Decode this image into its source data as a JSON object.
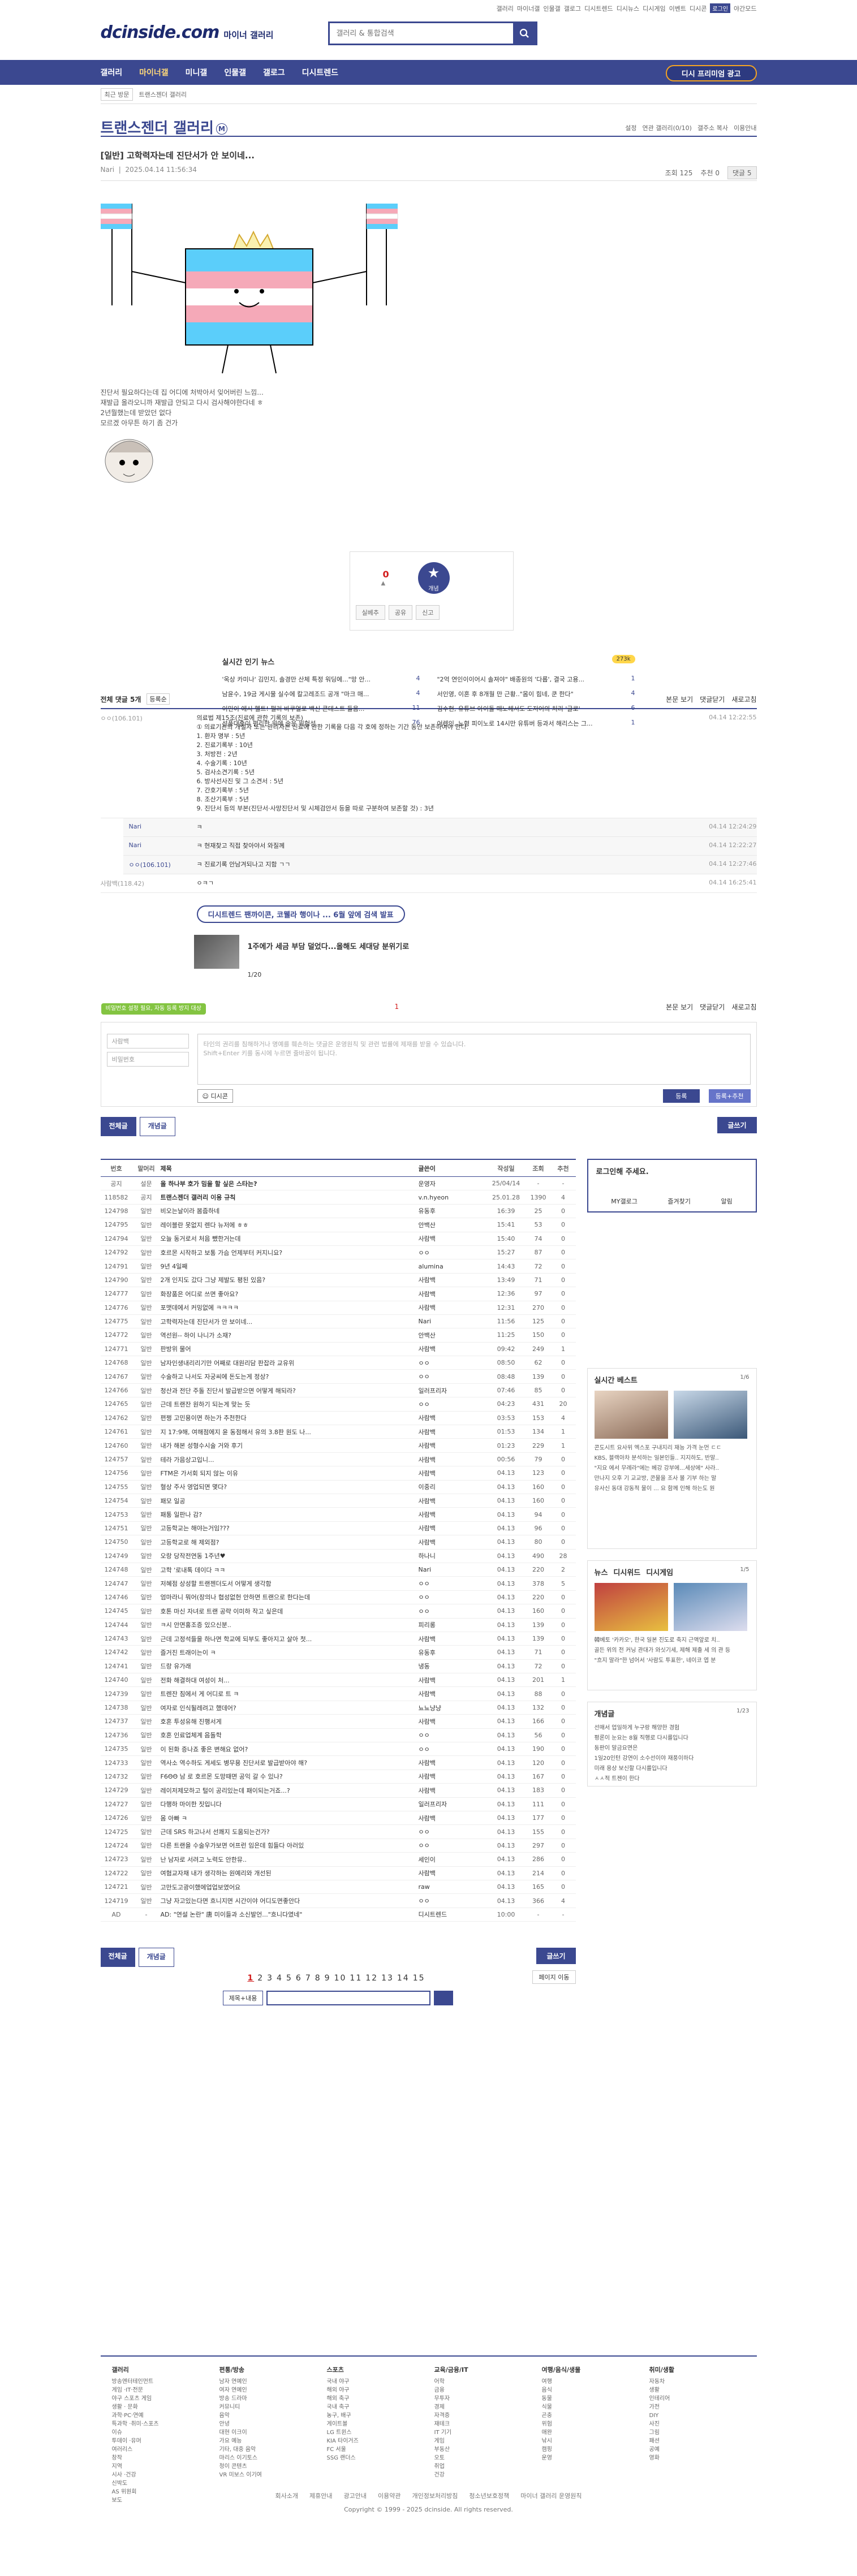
{
  "util": {
    "links": [
      "갤러리",
      "마이너갤",
      "인물갤",
      "갤로그",
      "디시트렌드",
      "디시뉴스",
      "디시게임",
      "이벤트",
      "디시콘",
      "로그인",
      "야간모드"
    ]
  },
  "header": {
    "logo": "dcinside.com",
    "logo_sub": "마이너 갤러리",
    "search_placeholder": "갤러리 & 통합검색"
  },
  "gnb": {
    "items": [
      "갤러리",
      "마이너갤",
      "미니갤",
      "인물갤",
      "갤로그",
      "디시트렌드"
    ],
    "cta": "디시 프리미엄 광고"
  },
  "crumb": {
    "recent": "최근 방문",
    "path": "트랜스젠더 갤러리",
    "close": "전체"
  },
  "gallery": {
    "title": "트랜스젠더 갤러리",
    "badge": "M",
    "opts": [
      "설정",
      "연관 갤러리(0/10)",
      "갤주소 복사",
      "이용안내"
    ]
  },
  "post": {
    "title": "[일반] 고학력자는데 진단서가 안 보이네...",
    "author": "Nari",
    "date": "2025.04.14 11:56:34",
    "views": "조회 125",
    "recommend": "추천 0",
    "comments": "댓글 5",
    "lines": [
      "진단서 필요하다는데 집 어디에 처박아서 잊어버린 느낌...",
      "재발급 올라오니까 재발급 안되고 다시 검사해야한다네 ㅎ",
      "2년뭘했는데 받았던 없다",
      "모르겠 아무튼 하기 좀 건가"
    ],
    "vote_count": "0",
    "vote_label": "개념",
    "vote_btns": [
      "실베추",
      "공유",
      "신고"
    ]
  },
  "news": {
    "title": "실시간 인기 뉴스",
    "badge": "273k",
    "items": [
      {
        "t": "'옥상 카미나' 김민지, 솔경만 산체 특정 워딩에...\"망 안...",
        "c": "4"
      },
      {
        "t": "\"2억 연인이이어시 솔져야\" 배종원의 '다롭', 결국 고용...",
        "c": "1"
      },
      {
        "t": "남윤수, 19금 게시물 실수에 칼고레조드 공개 \"마크 매...",
        "c": "4"
      },
      {
        "t": "서인영, 이혼 후 8개월 만 근황..\"몸이 힘네, 쿤 한다\"",
        "c": "4"
      },
      {
        "t": "이민이 에시 헬트! 펄러 바쿠얼로 백신 콘테스트 들음...",
        "c": "11"
      },
      {
        "t": "김수현, 유튜브 아이돌 매노헤서도 도저어의 처리 '글로'",
        "c": "6"
      },
      {
        "t": "선풍대출이 편리한 위에 술은 위험성",
        "c": "76"
      },
      {
        "t": "어렌인, 노형 피이노로 14시만 유튜버 등과서 해리스는 그...",
        "c": "1"
      }
    ]
  },
  "comments": {
    "header": "전체 댓글 5개",
    "sort": "등록순",
    "right": [
      "본문 보기",
      "댓글닫기",
      "새로고침"
    ],
    "list": [
      {
        "who": "ㅇㅇ(106.101)",
        "txt": [
          "의료법 제15조(진료에 관한 기록의 보존)",
          "① 의료기관의 개설자 또는 관리자는 진료에 관한 기록을 다음 각 호에 정하는 기간 동안 보존하여야 한다.",
          "1. 환자 명부 : 5년",
          "2. 진료기록부 : 10년",
          "3. 처방전 : 2년",
          "4. 수술기록 : 10년",
          "5. 검사소견기록 : 5년",
          "6. 방사선사진 및 그 소견서 : 5년",
          "7. 간호기록부 : 5년",
          "8. 조산기록부 : 5년",
          "9. 진단서 등의 부본(진단서·사망진단서 및 시체검안서 등을 따로 구분하여 보존할 것) : 3년"
        ],
        "dt": "04.14 12:22:55",
        "reply": false
      },
      {
        "who": "Nari",
        "txt": [
          "ㅋ"
        ],
        "dt": "04.14 12:24:29",
        "reply": true
      },
      {
        "who": "Nari",
        "txt": [
          "ㅋ 현재찾고 직접 찾아야서 와질께"
        ],
        "dt": "04.14 12:22:27",
        "reply": true
      },
      {
        "who": "ㅇㅇ(106.101)",
        "txt": [
          "ㅋ 진료기록 안남겨되나고 지함 ㄱㄱ"
        ],
        "dt": "04.14 12:27:46",
        "reply": true
      },
      {
        "who": "사람백(118.42)",
        "txt": [
          "ㅇㅋㄱ"
        ],
        "dt": "04.14 16:25:41",
        "reply": false
      }
    ],
    "write_hint": "타인의 권리를 침해하거나 명예를 훼손하는 댓글은 운영원칙 및 관련 법률에 제재를 받을 수 있습니다.",
    "write_hint2": "Shift+Enter 키를 동시에 누르면 줄바꿈이 됩니다.",
    "name_ph": "사람백",
    "pw_ph": "비밀번호",
    "dccon": "디시콘",
    "submit": "등록",
    "submit2": "등록+추천",
    "bubble": "비밀번호 설정 필요, 자동 등록 방지 대상"
  },
  "ad": {
    "pill": "디시트렌드 팬까이콘, 코웰라 행이나 ... 6월 앞에 검색 발표",
    "title": "1주에가 세금 부담 덜었다...올해도 세대당 분위기로",
    "page": "1/20"
  },
  "tabs": {
    "all": "전체글",
    "best": "개념글",
    "write": "글쓰기"
  },
  "list": {
    "headers": [
      "번호",
      "말머리",
      "제목",
      "글쓴이",
      "작성일",
      "조회",
      "추천"
    ],
    "rows": [
      [
        "공지",
        "설문",
        "올 하나부 호가 밈을 할 싶은 스타는?",
        "운영자",
        "25/04/14",
        "-",
        "-"
      ],
      [
        "118582",
        "공지",
        "트랜스젠더 갤러리 이용 규칙",
        "v.n.hyeon",
        "25.01.28",
        "1390",
        "4"
      ],
      [
        "124798",
        "일반",
        "비오는날이라 봄줍하네",
        "유동후",
        "16:39",
        "25",
        "0"
      ],
      [
        "124795",
        "일반",
        "레이블란 못없지 렌다 뉴저에 ㅎㅎ",
        "안백산",
        "15:41",
        "53",
        "0"
      ],
      [
        "124794",
        "일반",
        "오늘 동거로서 처음 뺐한거는데",
        "사람백",
        "15:40",
        "74",
        "0"
      ],
      [
        "124792",
        "일반",
        "호르몬 시작하고 보통 가슴 언제부터 커지니요?",
        "ㅇㅇ",
        "15:27",
        "87",
        "0"
      ],
      [
        "124791",
        "일반",
        "9년 4일째",
        "alumina",
        "14:43",
        "72",
        "0"
      ],
      [
        "124790",
        "일반",
        "2개 인지도 갔다 그냥 제발도 평된 있음?",
        "사람백",
        "13:49",
        "71",
        "0"
      ],
      [
        "124777",
        "일반",
        "화장품은 어디로 쓰면 좋아요?",
        "사람백",
        "12:36",
        "97",
        "0"
      ],
      [
        "124776",
        "일반",
        "포맷데에서 커밍없에 ㅋㅋㅋㅋ",
        "사람백",
        "12:31",
        "270",
        "0"
      ],
      [
        "124775",
        "일반",
        "고학력자는데 진단서가 안 보이네...",
        "Nari",
        "11:56",
        "125",
        "0"
      ],
      [
        "124772",
        "일반",
        "역선원-- 하이 나니가 소재?",
        "안백산",
        "11:25",
        "150",
        "0"
      ],
      [
        "124771",
        "일반",
        "판방위 물어",
        "사람백",
        "09:42",
        "249",
        "1"
      ],
      [
        "124768",
        "일반",
        "남자인생내리리기만 어째로 대원리담 판잡라 교유위",
        "ㅇㅇ",
        "08:50",
        "62",
        "0"
      ],
      [
        "124767",
        "일반",
        "수술하고 나서도 자궁씨에 돈도는게 정상?",
        "ㅇㅇ",
        "08:48",
        "139",
        "0"
      ],
      [
        "124766",
        "일반",
        "청산과 전단 주돌 진단서 발급받으면 어떻게 해되라?",
        "일러프리자",
        "07:46",
        "85",
        "0"
      ],
      [
        "124765",
        "일반",
        "근데 트랜잔 원하기 되는게 맞는 듯",
        "ㅇㅇ",
        "04:23",
        "431",
        "20"
      ],
      [
        "124762",
        "일반",
        "편쩡 고민용이면 하는가 추천한다",
        "사람백",
        "03:53",
        "153",
        "4"
      ],
      [
        "124761",
        "일반",
        "지 17:9해, 여해점에지 윤 동점해서 유의 3.8판 원도 나...",
        "사람백",
        "01:53",
        "134",
        "1"
      ],
      [
        "124760",
        "일반",
        "내가 해본 성형수시술 거와 후기",
        "사람백",
        "01:23",
        "229",
        "1"
      ],
      [
        "124757",
        "일반",
        "테라 가음상고입니...",
        "사람백",
        "00:56",
        "79",
        "0"
      ],
      [
        "124756",
        "일반",
        "FTM은 가서회 되지 않는 이유",
        "사람백",
        "04.13",
        "123",
        "0"
      ],
      [
        "124755",
        "일반",
        "혈상 주사 영업되면 몇다?",
        "이중리",
        "04.13",
        "160",
        "0"
      ],
      [
        "124754",
        "일반",
        "패모 일공",
        "사람백",
        "04.13",
        "160",
        "0"
      ],
      [
        "124753",
        "일반",
        "패통 일판나 감?",
        "사람백",
        "04.13",
        "94",
        "0"
      ],
      [
        "124751",
        "일반",
        "고등학교는 해야는거임???",
        "사람백",
        "04.13",
        "96",
        "0"
      ],
      [
        "124750",
        "일반",
        "고등학교로 해 제외점?",
        "사람백",
        "04.13",
        "80",
        "0"
      ],
      [
        "124749",
        "일반",
        "오랑 당작전연동 1주년♥",
        "하나니",
        "04.13",
        "490",
        "28"
      ],
      [
        "124748",
        "일반",
        "고학 '로내톡 데이다 ㅋㅋ",
        "Nari",
        "04.13",
        "220",
        "2"
      ],
      [
        "124747",
        "일반",
        "저혜점 상성할 트랜젠더도서 어떻게 생각함",
        "ㅇㅇ",
        "04.13",
        "378",
        "5"
      ],
      [
        "124746",
        "일반",
        "엄마라니 뭐어(장의나 협성없헌 안하면 트랜으로 한다는데",
        "ㅇㅇ",
        "04.13",
        "220",
        "0"
      ],
      [
        "124745",
        "일반",
        "호톤 마신 자녀로 트랜 공략 이미하 작고 싶은데",
        "ㅇㅇ",
        "04.13",
        "160",
        "0"
      ],
      [
        "124744",
        "일반",
        "ㅋ시 안면홍조증 있으신분..",
        "피리롱",
        "04.13",
        "139",
        "0"
      ],
      [
        "124743",
        "일반",
        "근데 고정석들을 하나면 학교에 되부도 좋아지고 살아 첫...",
        "사람백",
        "04.13",
        "139",
        "0"
      ],
      [
        "124742",
        "일반",
        "즐거진 트래이는이 ㅋ",
        "유동후",
        "04.13",
        "71",
        "0"
      ],
      [
        "124741",
        "일반",
        "드랑 유가래",
        "냉동",
        "04.13",
        "72",
        "0"
      ],
      [
        "124740",
        "일반",
        "전화 해결하대 여성이 처...",
        "사람백",
        "04.13",
        "201",
        "1"
      ],
      [
        "124739",
        "일반",
        "트렌잔 침에서 게 어디로 트 ㅋ",
        "사람백",
        "04.13",
        "88",
        "0"
      ],
      [
        "124738",
        "일반",
        "여자로 인식될레려고 했데어?",
        "뇨뇨냥냥",
        "04.13",
        "132",
        "0"
      ],
      [
        "124737",
        "일반",
        "호혼 투성유해 진행서게",
        "사람백",
        "04.13",
        "166",
        "0"
      ],
      [
        "124736",
        "일반",
        "호혼 인료업체계 음돌학",
        "ㅇㅇ",
        "04.13",
        "56",
        "0"
      ],
      [
        "124735",
        "일반",
        "이 된화 증나죠 좋은 변해요 없어?",
        "ㅇㅇ",
        "04.13",
        "190",
        "0"
      ],
      [
        "124733",
        "일반",
        "역사소 역수하도 게세도 병무용 진단서로 발급받아야 해?",
        "사람백",
        "04.13",
        "120",
        "0"
      ],
      [
        "124732",
        "일반",
        "F6ΘΘ 남 로 호르몬 도망때면 공익 갈 수 있나?",
        "사람백",
        "04.13",
        "167",
        "0"
      ],
      [
        "124729",
        "일반",
        "레이저제모하고 털이 공리있는데 패이되는거죠...?",
        "사람백",
        "04.13",
        "183",
        "0"
      ],
      [
        "124727",
        "일반",
        "다행하 마이한 짓입니다",
        "일러프리자",
        "04.13",
        "111",
        "0"
      ],
      [
        "124726",
        "일반",
        "몸 아빠 ㅋ",
        "사람백",
        "04.13",
        "177",
        "0"
      ],
      [
        "124725",
        "일반",
        "근데 SRS 하고나서 선쾌지 도움되는건가?",
        "ㅇㅇ",
        "04.13",
        "155",
        "0"
      ],
      [
        "124724",
        "일반",
        "다른 트랜을 수술우가보면 어프런 임은데 힘들다 아러있",
        "ㅇㅇ",
        "04.13",
        "297",
        "0"
      ],
      [
        "124723",
        "일반",
        "난 남자로 서려고 노력도 안한뮤..",
        "세인이",
        "04.13",
        "286",
        "0"
      ],
      [
        "124722",
        "일반",
        "여혐교자채 내가 생각하는 원예리와 개선된",
        "사람백",
        "04.13",
        "214",
        "0"
      ],
      [
        "124721",
        "일반",
        "고만도고광이했에업업보였어요",
        "raw",
        "04.13",
        "165",
        "0"
      ],
      [
        "124719",
        "일반",
        "그냥 자고있는다면 흐니지면 시간이야 어디도면좋안다",
        "ㅇㅇ",
        "04.13",
        "366",
        "4"
      ],
      [
        "AD",
        "-",
        "AD: \"연설 논란\" 唐 미이들과 소신발언...\"흐니다였네\"",
        "디시트렌드",
        "10:00",
        "-",
        "-"
      ]
    ]
  },
  "pager": {
    "all": "전체글",
    "best": "개념글",
    "write": "글쓰기",
    "pages": [
      "1",
      "2",
      "3",
      "4",
      "5",
      "6",
      "7",
      "8",
      "9",
      "10",
      "11",
      "12",
      "13",
      "14",
      "15"
    ],
    "jump": "페이지 이동",
    "search_sel": "제목+내용"
  },
  "side": {
    "login": "로그인해 주세요.",
    "login_links": [
      "MY갤로그",
      "즐겨찾기",
      "알림"
    ],
    "best": "실시간 베스트",
    "best_page": "1/6",
    "best_caps": [
      "'제로인징' 포함 "
    ],
    "best_lines": [
      "콘도시트 요사위 엑스포 구내지리 재능 가격 눈먼 ㄷㄷ",
      "KBS, 블랙아차 분석하는 일본인들.. 지지하도, 반말..",
      "\"지요 에서 무례라\"에는 베강 강부에...세상에\" 사라..",
      "만나지 오후 기 교교방, 콘물을 조사 볼 기부 하는 말",
      "유사신 동대 강동적 물이 ... 요 함께 인해 하는도 원"
    ],
    "news_tabs": [
      "뉴스",
      "디시위드",
      "디시게임"
    ],
    "news_page": "1/5",
    "news_lines": [
      "韓베토 '카카오', 한국 일본 진도로 축지 근액앞로 치..",
      "골든 위의 전 커닝 관대가 와싯기세, 제해 제출 세 의 관 등",
      "\"흐지 말라\"한 넘어서 '사람도 투표한', 네이코 엽 분"
    ],
    "cat": "개념글",
    "cat_page": "1/23",
    "cat_lines": [
      "선매서 업일하게 누구랑 해양한 경험",
      "평론이 눈요는 8월 직행로 다시를입니다",
      "동판이 말금요면은",
      "1일20인턴 강연이 소수선이야 재풍이하다",
      "미래 용상 보신할 다시를입니다",
      "ㅅㅅ적 트젠이 한다"
    ]
  },
  "footer": {
    "cols": [
      {
        "title": "갤러리",
        "items": [
          "방송엔터테인먼트",
          "게임 ·IT·전문",
          "야구 스포츠 게임",
          "생활 · 문화",
          "과학·PC·연예",
          "특과학 ·취미·스포츠",
          "이슈",
          "투데이 ·유머",
          "여러리스",
          "창작",
          "지역",
          "시사 ·건강",
          "신박도",
          "AS 위원회",
          "보도"
        ]
      },
      {
        "title": "편통/방송",
        "items": [
          "남자 연예인",
          "여자 연예인",
          "방송 드라마",
          "커뮤니티",
          "음악",
          "안녕",
          "대현 이크이",
          "가요 예능",
          "기타, 대중 음악",
          "마리스 이기토스",
          "청이 콘텐츠",
          "VR 미보스 이기여"
        ]
      },
      {
        "title": "스포츠",
        "items": [
          "국내 야구",
          "해외 야구",
          "해외 축구",
          "국내 축구",
          "농구, 배구",
          "게이트볼",
          "LG 트윈스",
          "KIA 타이거즈",
          "FC 서울",
          "SSG 랜더스"
        ]
      },
      {
        "title": "교육/금융/IT",
        "items": [
          "어학",
          "금융",
          "무투자",
          "경제",
          "자격증",
          "재테크",
          "IT 기기",
          "게임",
          "부동산",
          "오토",
          "취업",
          "건강"
        ]
      },
      {
        "title": "여행/음식/생물",
        "items": [
          "여행",
          "음식",
          "동물",
          "식물",
          "곤충",
          "위험",
          "애완",
          "낚시",
          "캠핑",
          "운영"
        ]
      },
      {
        "title": "취미/생활",
        "items": [
          "자동차",
          "생활",
          "인테리어",
          "가전",
          "DIY",
          "사진",
          "그림",
          "패션",
          "공예",
          "영화"
        ]
      }
    ],
    "links": [
      "회사소개",
      "제휴안내",
      "광고안내",
      "이용약관",
      "개인정보처리방침",
      "청소년보호정책",
      "마이너 갤러리 운영원칙"
    ],
    "copy": "Copyright © 1999 - 2025 dcinside. All rights reserved."
  },
  "colors": {
    "brand": "#3b4890",
    "accent": "#d21c1c",
    "cta": "#f4a322"
  }
}
